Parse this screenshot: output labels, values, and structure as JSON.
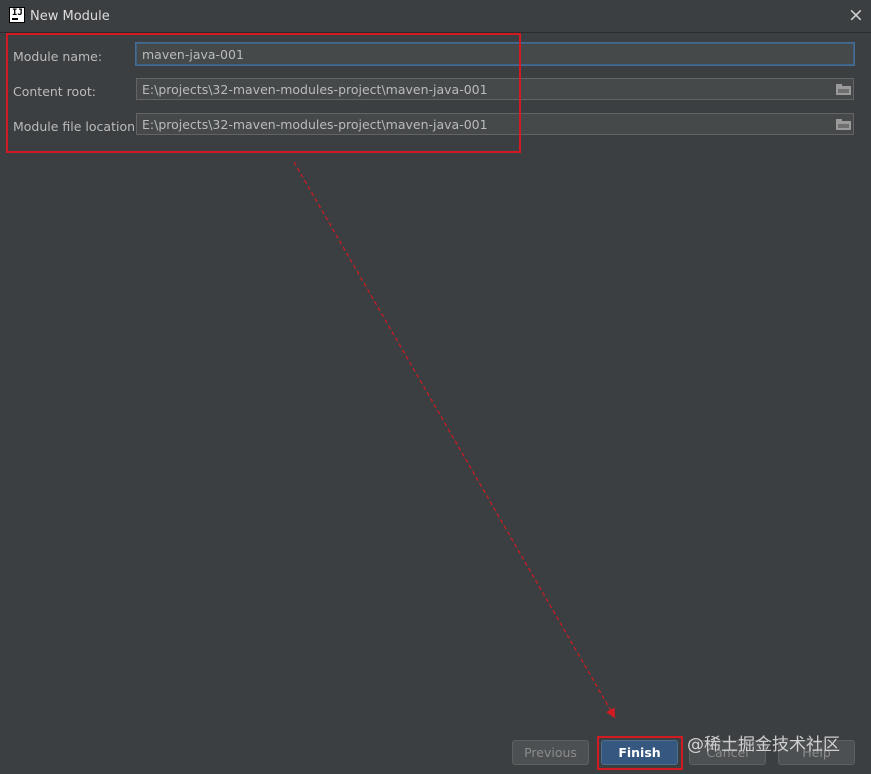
{
  "window": {
    "title": "New Module",
    "close_icon": "close-icon",
    "app_icon": "intellij-idea-icon"
  },
  "form": {
    "module_name": {
      "label": "Module name:",
      "value": "maven-java-001"
    },
    "content_root": {
      "label": "Content root:",
      "value": "E:\\projects\\32-maven-modules-project\\maven-java-001",
      "icon": "folder-icon"
    },
    "module_file_location": {
      "label": "Module file location:",
      "value": "E:\\projects\\32-maven-modules-project\\maven-java-001",
      "icon": "folder-icon"
    }
  },
  "buttons": {
    "previous": "Previous",
    "finish": "Finish",
    "cancel": "Cancel",
    "help": "Help"
  },
  "watermark": "@稀土掘金技术社区",
  "colors": {
    "background": "#3c3f41",
    "field_background": "#45494a",
    "primary_button": "#365880",
    "annotation_red": "#d11a22"
  }
}
